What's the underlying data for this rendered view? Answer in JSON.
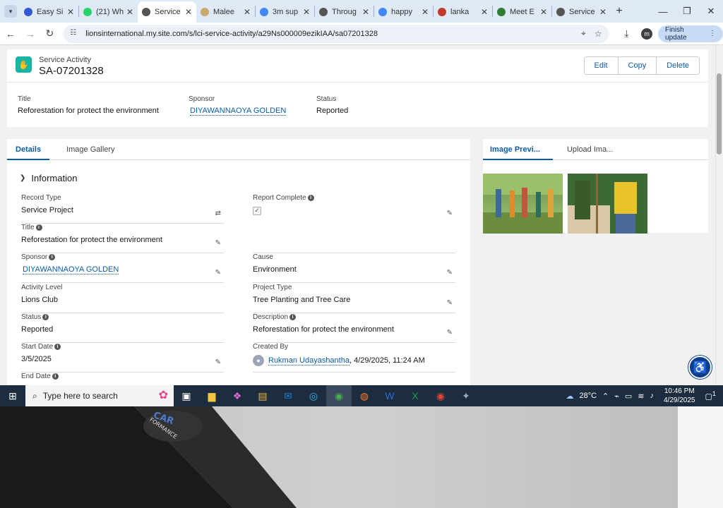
{
  "browser": {
    "tabs": [
      {
        "label": "Easy Si",
        "icon": "dart-icon",
        "color": "#2f5bd3"
      },
      {
        "label": "(21) Wh",
        "icon": "whatsapp-icon",
        "color": "#25d366"
      },
      {
        "label": "Service",
        "icon": "globe-icon",
        "color": "#555555",
        "active": true
      },
      {
        "label": "Malee",
        "icon": "document-icon",
        "color": "#c9a96e"
      },
      {
        "label": "3m sup",
        "icon": "google-icon",
        "color": "#4285f4"
      },
      {
        "label": "Throug",
        "icon": "globe-icon",
        "color": "#555555"
      },
      {
        "label": "happy",
        "icon": "google-icon",
        "color": "#4285f4"
      },
      {
        "label": "lanka",
        "icon": "copyright-icon",
        "color": "#c0392b"
      },
      {
        "label": "Meet E",
        "icon": "lions-icon",
        "color": "#2e7d32"
      },
      {
        "label": "Service",
        "icon": "globe-icon",
        "color": "#555555"
      }
    ],
    "url": "lionsinternational.my.site.com/s/lci-service-activity/a29Ns000009ezikIAA/sa07201328",
    "profile_initial": "m",
    "finish_update": "Finish update"
  },
  "record": {
    "object_label": "Service Activity",
    "name": "SA-07201328",
    "actions": [
      "Edit",
      "Copy",
      "Delete"
    ]
  },
  "highlights": {
    "title_label": "Title",
    "title_value": "Reforestation for protect the environment",
    "sponsor_label": "Sponsor",
    "sponsor_value": "DIYAWANNAOYA GOLDEN",
    "status_label": "Status",
    "status_value": "Reported"
  },
  "main_tabs": [
    "Details",
    "Image Gallery"
  ],
  "section": "Information",
  "fields": {
    "record_type": {
      "label": "Record Type",
      "value": "Service Project"
    },
    "report_complete": {
      "label": "Report Complete"
    },
    "title": {
      "label": "Title",
      "value": "Reforestation for protect the environment"
    },
    "sponsor": {
      "label": "Sponsor",
      "value": "DIYAWANNAOYA GOLDEN"
    },
    "cause": {
      "label": "Cause",
      "value": "Environment"
    },
    "activity_level": {
      "label": "Activity Level",
      "value": "Lions Club"
    },
    "project_type": {
      "label": "Project Type",
      "value": "Tree Planting and Tree Care"
    },
    "status": {
      "label": "Status",
      "value": "Reported"
    },
    "description": {
      "label": "Description",
      "value": "Reforestation for protect the environment"
    },
    "start_date": {
      "label": "Start Date",
      "value": "3/5/2025"
    },
    "created_by": {
      "label": "Created By",
      "user": "Rukman Udayashantha",
      "timestamp": ", 4/29/2025, 11:24 AM"
    },
    "end_date": {
      "label": "End Date"
    }
  },
  "side_tabs": [
    "Image Previ...",
    "Upload Ima..."
  ],
  "taskbar": {
    "search_placeholder": "Type here to search",
    "temperature": "28°C",
    "time": "10:46 PM",
    "date": "4/29/2025",
    "notification_count": "1"
  },
  "colors": {
    "link": "#0b5cab",
    "record_icon": "#18b5a5",
    "taskbar": "#1c2d3f"
  }
}
